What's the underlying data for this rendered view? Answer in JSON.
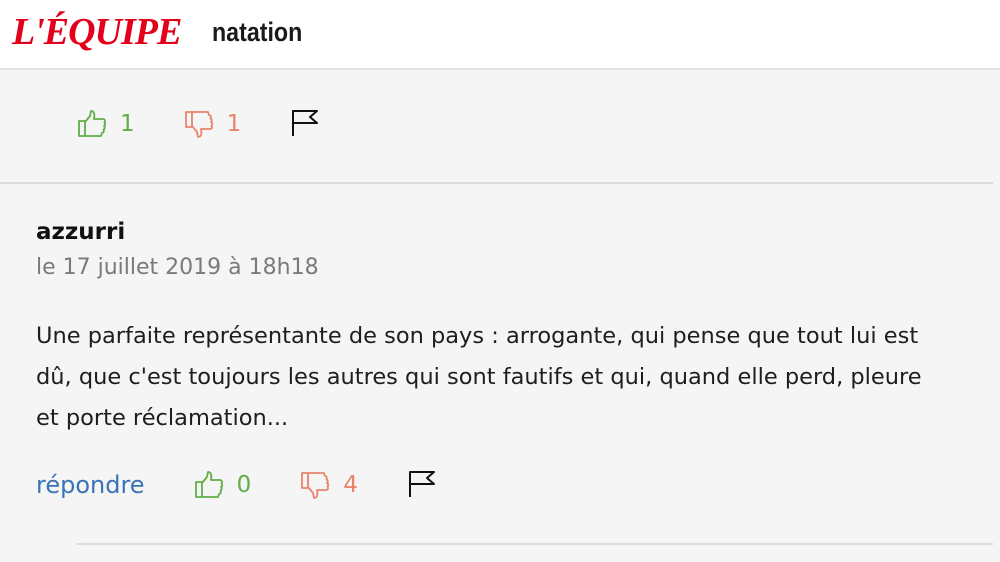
{
  "header": {
    "logo_text": "L'ÉQUIPE",
    "section": "natation",
    "brand_color": "#e2001a"
  },
  "previous_comment": {
    "likes": "1",
    "dislikes": "1"
  },
  "comment": {
    "username": "azzurri",
    "date": "le 17 juillet 2019 à 18h18",
    "text": "Une parfaite représentante de son pays : arrogante, qui pense que tout lui est dû, que c'est toujours les autres qui sont fautifs et qui, quand elle perd, pleure et porte réclamation...",
    "reply_label": "répondre",
    "likes": "0",
    "dislikes": "4"
  },
  "icons": {
    "like": "thumbs-up-icon",
    "dislike": "thumbs-down-icon",
    "report": "flag-icon"
  },
  "colors": {
    "like": "#5fae47",
    "dislike": "#e8846a",
    "link": "#3a73b8"
  }
}
